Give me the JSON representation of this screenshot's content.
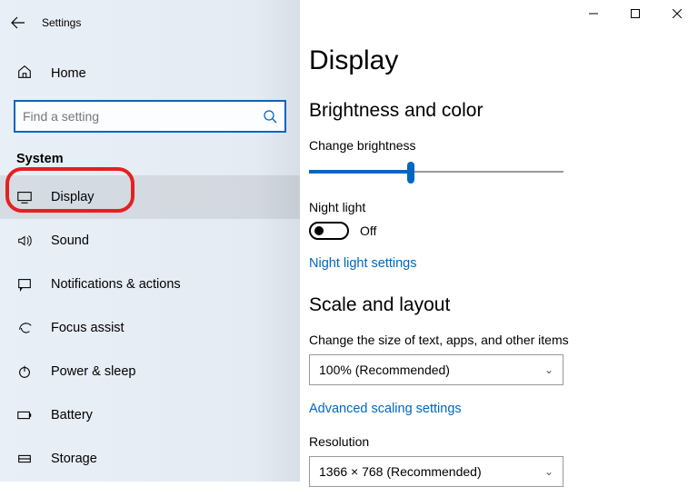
{
  "titlebar": {
    "title": "Settings"
  },
  "sidebar": {
    "home_label": "Home",
    "search_placeholder": "Find a setting",
    "category": "System",
    "items": [
      {
        "label": "Display"
      },
      {
        "label": "Sound"
      },
      {
        "label": "Notifications & actions"
      },
      {
        "label": "Focus assist"
      },
      {
        "label": "Power & sleep"
      },
      {
        "label": "Battery"
      },
      {
        "label": "Storage"
      }
    ]
  },
  "main": {
    "heading": "Display",
    "section1": "Brightness and color",
    "brightness_label": "Change brightness",
    "brightness_percent": 40,
    "nightlight_label": "Night light",
    "nightlight_state": "Off",
    "nightlight_link": "Night light settings",
    "section2": "Scale and layout",
    "scale_label": "Change the size of text, apps, and other items",
    "scale_value": "100% (Recommended)",
    "scale_link": "Advanced scaling settings",
    "resolution_label": "Resolution",
    "resolution_value": "1366 × 768 (Recommended)"
  }
}
